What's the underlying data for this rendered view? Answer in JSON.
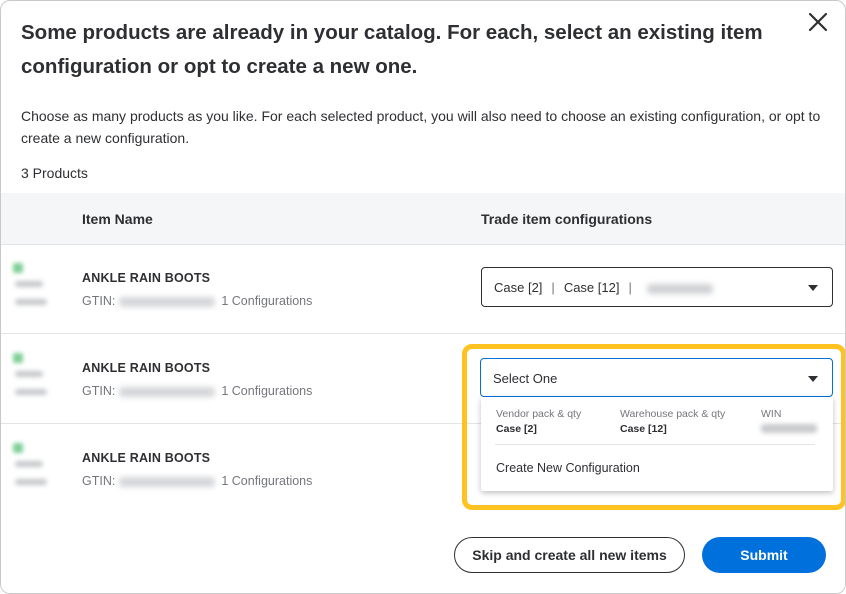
{
  "modal": {
    "title": "Some products are already in your catalog. For each, select an existing item configuration or opt to create a new one.",
    "description": "Choose as many products as you like. For each selected product, you will also need to choose an existing configuration, or opt to create a new configuration.",
    "product_count": "3 Products",
    "close_icon": "close-icon"
  },
  "table": {
    "headers": {
      "item_name": "Item Name",
      "trade_config": "Trade item configurations"
    },
    "rows": [
      {
        "name": "ANKLE RAIN BOOTS",
        "gtin_label": "GTIN:",
        "configs": "1 Configurations",
        "selection": {
          "part1": "Case [2]",
          "part2": "Case [12]",
          "separator": "|"
        }
      },
      {
        "name": "ANKLE RAIN BOOTS",
        "gtin_label": "GTIN:",
        "configs": "1 Configurations",
        "selection": {
          "placeholder": "Select One"
        }
      },
      {
        "name": "ANKLE RAIN BOOTS",
        "gtin_label": "GTIN:",
        "configs": "1 Configurations"
      }
    ]
  },
  "dropdown": {
    "option_existing": {
      "vendor_label": "Vendor pack & qty",
      "vendor_value": "Case [2]",
      "warehouse_label": "Warehouse pack & qty",
      "warehouse_value": "Case [12]",
      "win_label": "WIN"
    },
    "option_new": "Create New Configuration"
  },
  "footer": {
    "skip_label": "Skip and create all new items",
    "submit_label": "Submit"
  },
  "colors": {
    "primary": "#0071dc",
    "highlight": "#ffc220",
    "text": "#2e2f32",
    "muted": "#74767c"
  }
}
